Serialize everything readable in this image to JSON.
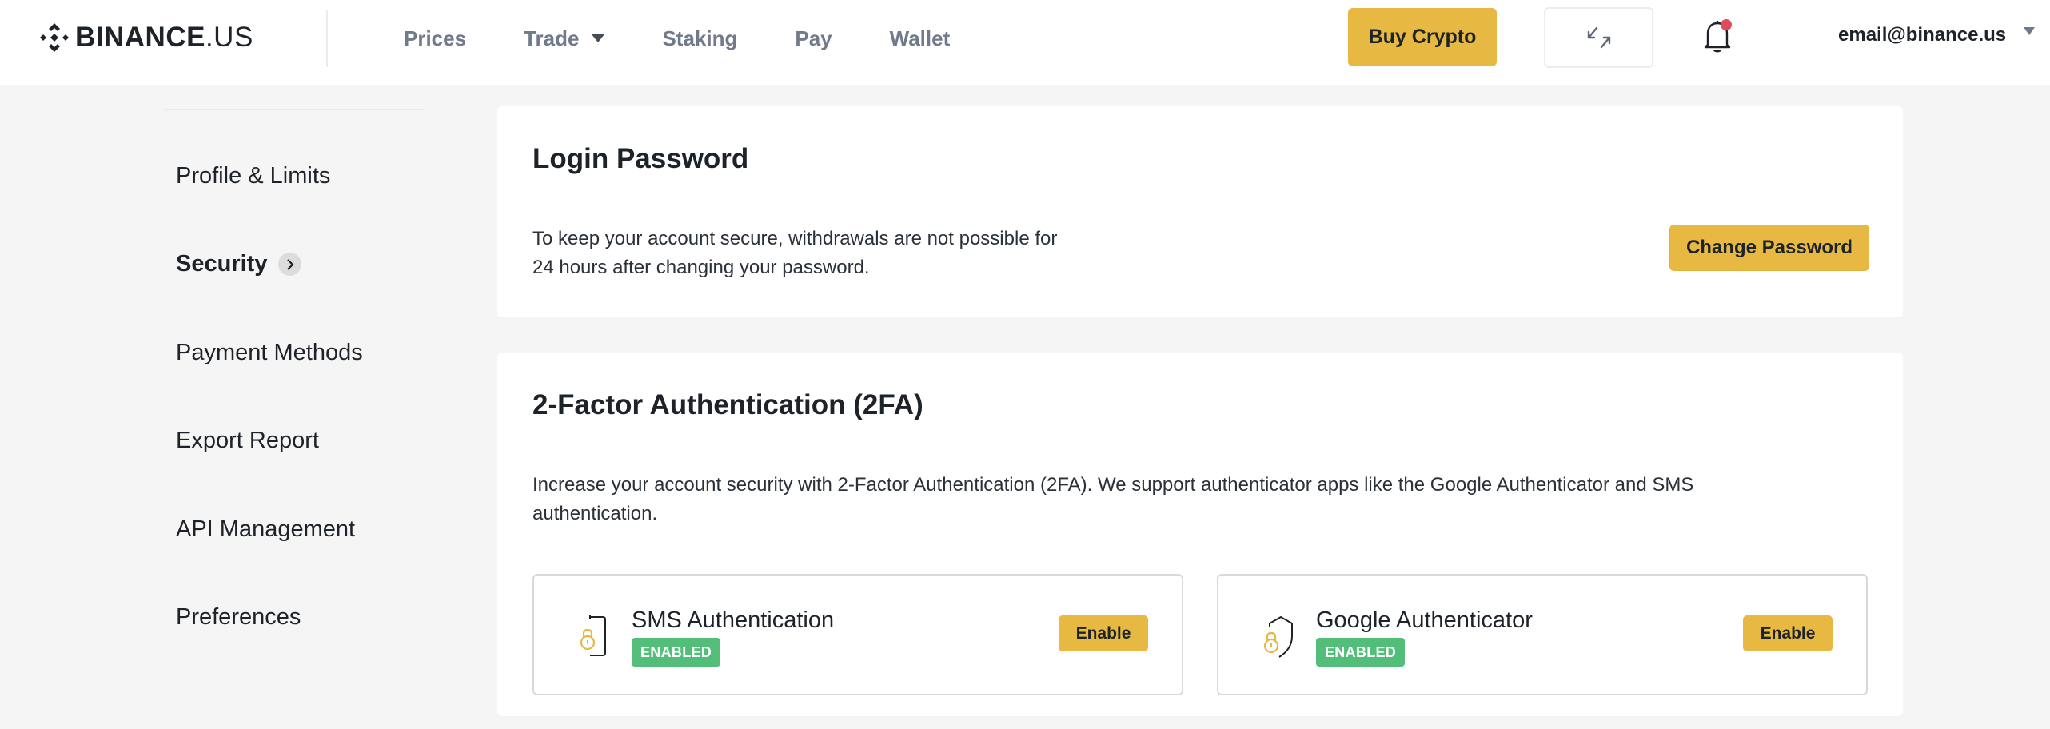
{
  "header": {
    "logo": {
      "brand": "BINANCE",
      "suffix": ".US"
    },
    "nav": [
      {
        "label": "Prices",
        "has_dropdown": false
      },
      {
        "label": "Trade",
        "has_dropdown": true
      },
      {
        "label": "Staking",
        "has_dropdown": false
      },
      {
        "label": "Pay",
        "has_dropdown": false
      },
      {
        "label": "Wallet",
        "has_dropdown": false
      }
    ],
    "buy_crypto_label": "Buy Crypto",
    "swap_icon": "swap-arrows-icon",
    "notification_icon": "bell-icon",
    "notification_unread": true,
    "account_email": "email@binance.us"
  },
  "sidebar": {
    "items": [
      {
        "label": "Profile & Limits",
        "active": false
      },
      {
        "label": "Security",
        "active": true
      },
      {
        "label": "Payment Methods",
        "active": false
      },
      {
        "label": "Export Report",
        "active": false
      },
      {
        "label": "API Management",
        "active": false
      },
      {
        "label": "Preferences",
        "active": false
      }
    ]
  },
  "login_password": {
    "title": "Login Password",
    "description_line1": "To keep your account secure, withdrawals are not possible for",
    "description_line2": "24 hours after changing your password.",
    "button_label": "Change Password"
  },
  "two_factor": {
    "title": "2-Factor Authentication (2FA)",
    "description_line1": "Increase your account security with 2-Factor Authentication (2FA). We support authenticator apps like the Google Authenticator and SMS",
    "description_line2": "authentication.",
    "methods": [
      {
        "name": "SMS Authentication",
        "status": "ENABLED",
        "button_label": "Enable",
        "icon": "phone-lock-icon"
      },
      {
        "name": "Google Authenticator",
        "status": "ENABLED",
        "button_label": "Enable",
        "icon": "shield-lock-icon"
      }
    ]
  },
  "colors": {
    "accent": "#e8b942",
    "enabled_badge": "#52be7a",
    "notification_dot": "#e24a5a",
    "page_bg": "#f5f5f5"
  }
}
